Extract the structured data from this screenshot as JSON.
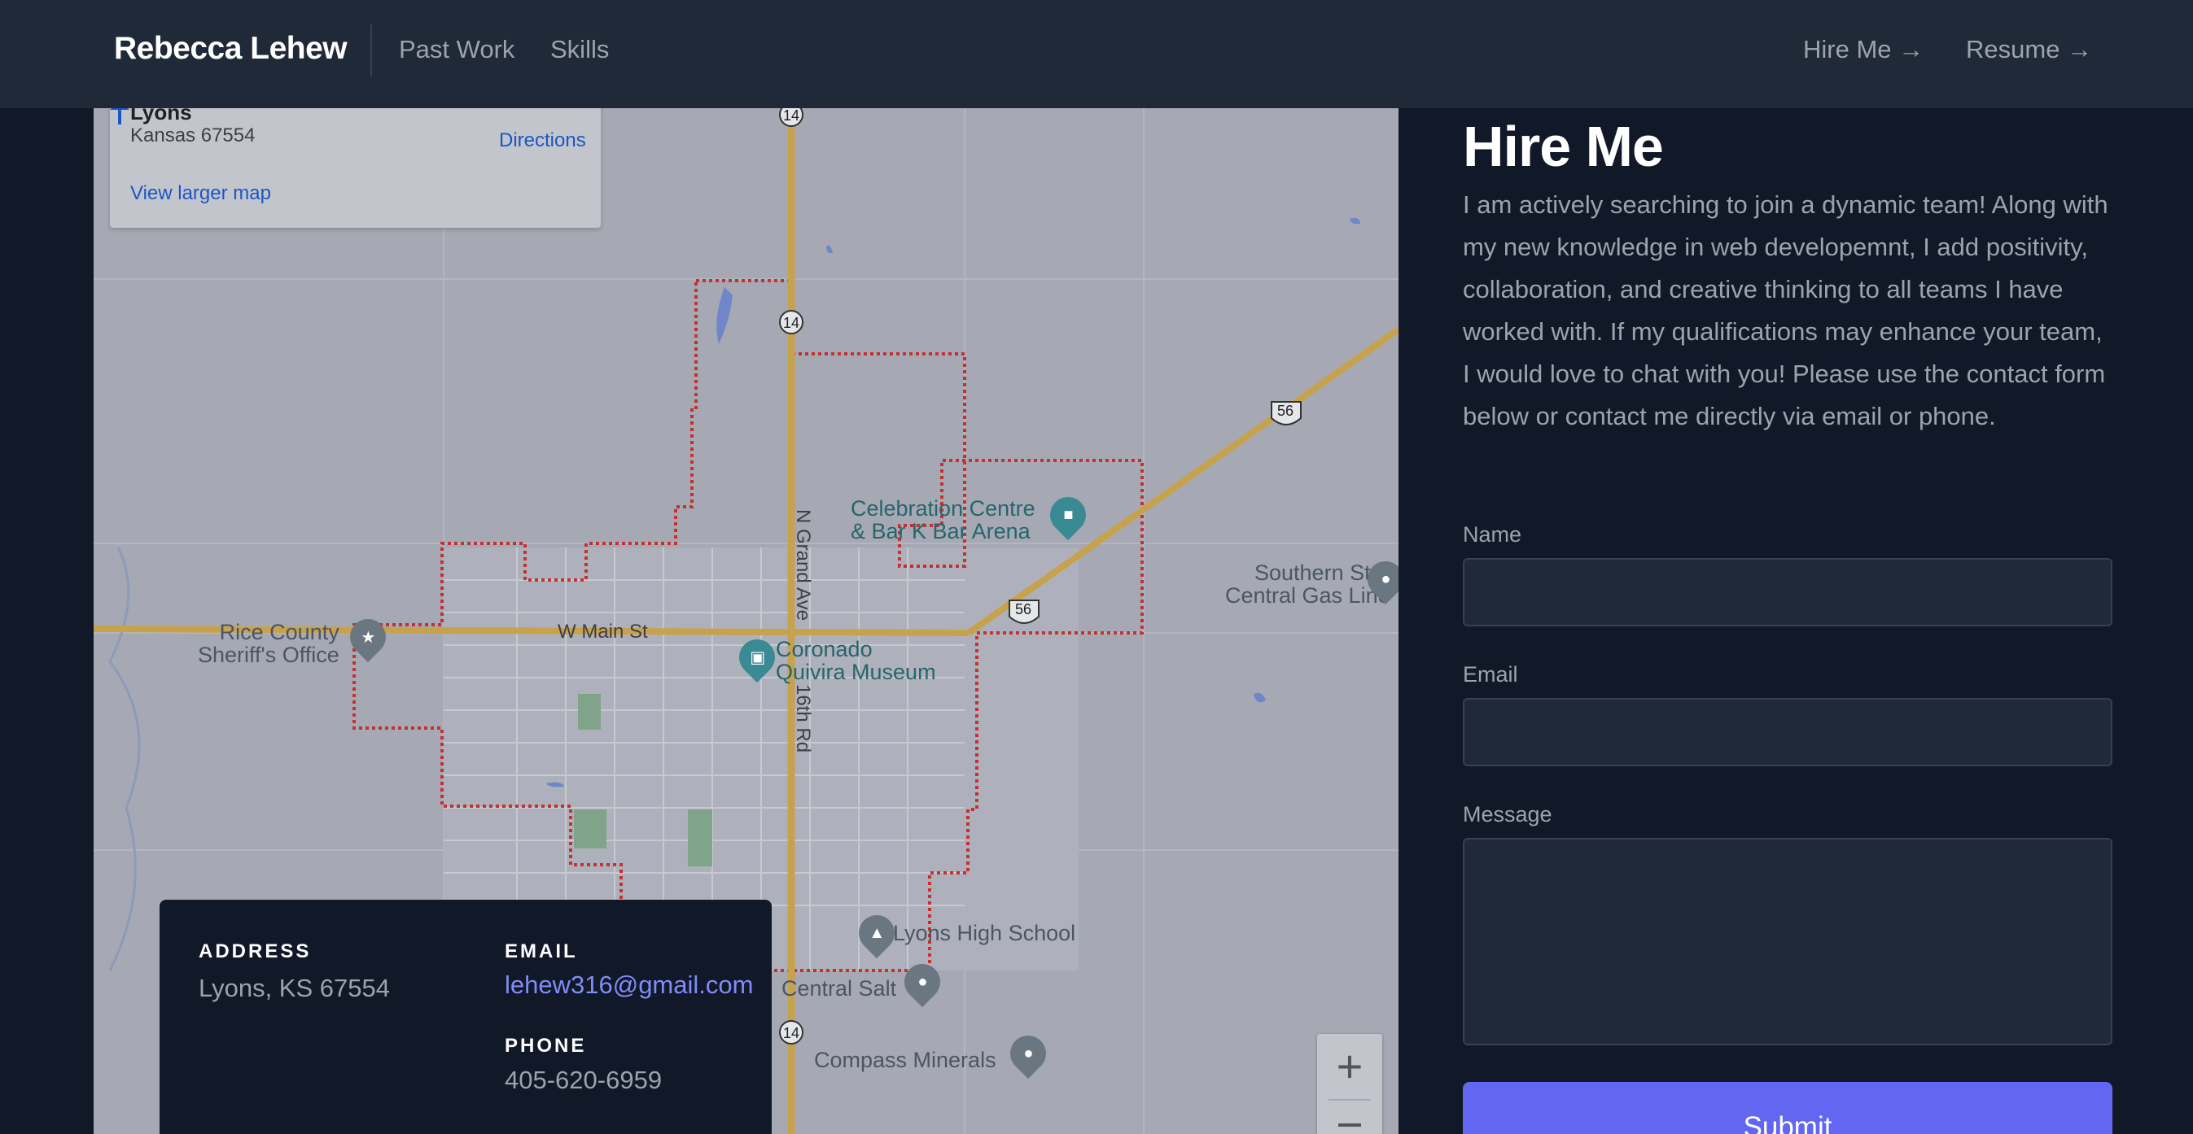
{
  "nav": {
    "brand": "Rebecca Lehew",
    "past_work": "Past Work",
    "skills": "Skills",
    "hire_me": "Hire Me →",
    "resume": "Resume →"
  },
  "map": {
    "card": {
      "title": "Lyons",
      "address": "Kansas 67554",
      "directions": "Directions",
      "larger_map": "View larger map"
    },
    "labels": {
      "celebration": [
        "Celebration Centre",
        "& Bar K Bar Arena"
      ],
      "southern_star": [
        "Southern Star",
        "Central Gas Line"
      ],
      "sheriff": [
        "Rice County",
        "Sheriff's Office"
      ],
      "main_st": "W Main St",
      "coronado": [
        "Coronado",
        "Quivira Museum"
      ],
      "grand_ave": "N Grand Ave",
      "road_16th": "16th Rd",
      "high_school": "Lyons High School",
      "central_salt": "Central Salt",
      "compass": "Compass Minerals",
      "hwy14": "14",
      "hwy56": "56"
    },
    "zoom_in": "+"
  },
  "contact": {
    "address_label": "ADDRESS",
    "address_value": "Lyons, KS 67554",
    "email_label": "EMAIL",
    "email_value": "lehew316@gmail.com",
    "phone_label": "PHONE",
    "phone_value": "405-620-6959"
  },
  "hire": {
    "title": "Hire Me",
    "text": "I am actively searching to join a dynamic team! Along with my new knowledge in web developemnt, I add positivity, collaboration, and creative thinking to all teams I have worked with. If my qualifications may enhance your team, I would love to chat with you! Please use the contact form below or contact me directly via email or phone."
  },
  "form": {
    "name_label": "Name",
    "email_label": "Email",
    "message_label": "Message",
    "submit": "Submit"
  },
  "colors": {
    "page_bg": "#111827",
    "nav_bg": "#1f2937",
    "accent": "#6366f1",
    "link": "#818cf8"
  }
}
